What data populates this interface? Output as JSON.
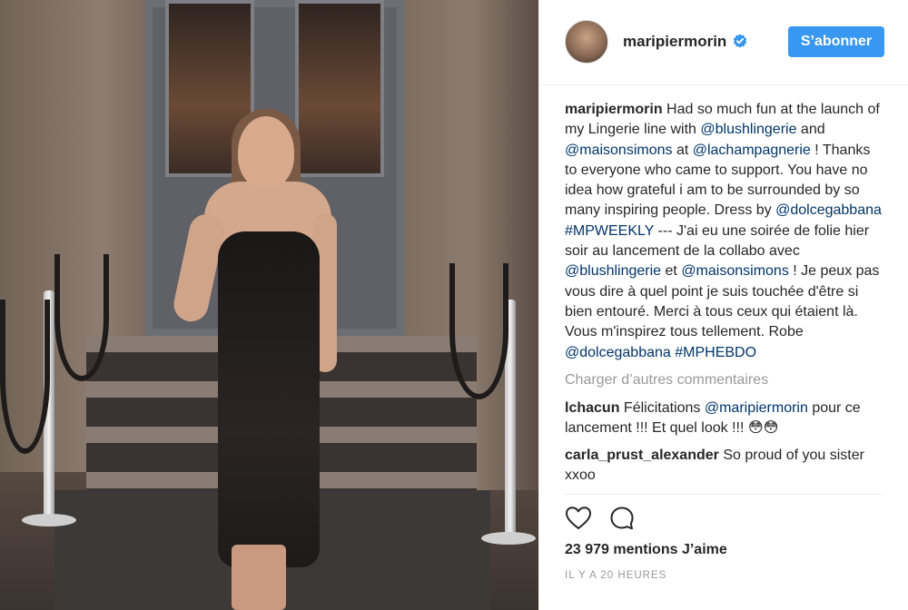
{
  "post": {
    "image_alt": "Woman in black lace dress standing on steps in front of a door",
    "username": "maripiermorin",
    "verified": true,
    "follow_label": "S’abonner",
    "caption": {
      "username": "maripiermorin",
      "t1": " Had so much fun at the launch of my Lingerie line with ",
      "m1": "@blushlingerie",
      "t2": " and ",
      "m2": "@maisonsimons",
      "t3": " at ",
      "m3": "@lachampagnerie",
      "t4": " ! Thanks to everyone who came to support. You have no idea how grateful i am to be surrounded by so many inspiring people. Dress by ",
      "m4": "@dolcegabbana",
      "t5": " ",
      "m5": "#MPWEEKLY",
      "t6": " --- J'ai eu une soirée de folie hier soir au lancement de la collabo avec ",
      "m6": "@blushlingerie",
      "t7": " et ",
      "m7": "@maisonsimons",
      "t8": " ! Je peux pas vous dire à quel point je suis touchée d'être si bien entouré. Merci à tous ceux qui étaient là. Vous m'inspirez tous tellement. Robe ",
      "m8": "@dolcegabbana",
      "t9": " ",
      "m9": "#MPHEBDO"
    },
    "load_more": "Charger d’autres commentaires",
    "comments": [
      {
        "username": "lchacun",
        "t1": " Félicitations ",
        "m1": "@maripiermorin",
        "t2": " pour ce lancement !!! Et quel look !!! 😳😳"
      },
      {
        "username": "carla_prust_alexander",
        "t1": " So proud of you sister xxoo"
      }
    ],
    "likes": "23 979 mentions J’aime",
    "timestamp": "IL Y A 20 HEURES",
    "icons": {
      "like": "heart-icon",
      "comment": "comment-bubble-icon",
      "verified": "verified-badge-icon"
    },
    "colors": {
      "accent": "#3897f0",
      "link": "#003569",
      "muted": "#999999"
    }
  }
}
